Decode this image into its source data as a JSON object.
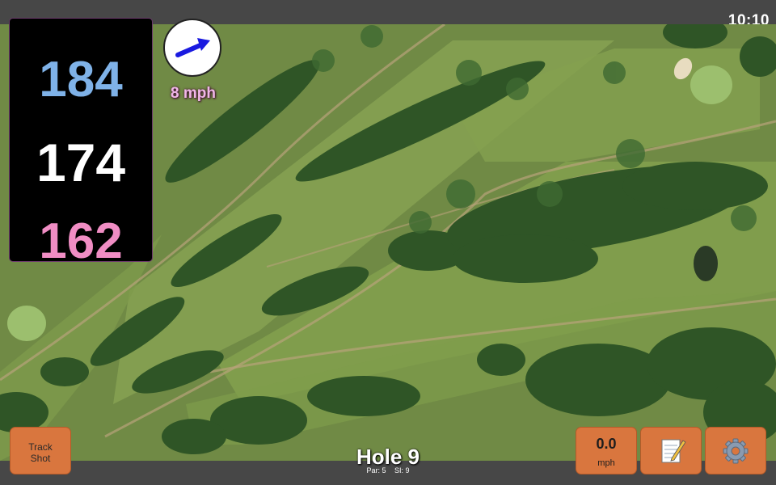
{
  "status_bar": {
    "time": "10:10"
  },
  "distances": {
    "back": "184",
    "middle": "174",
    "front": "162"
  },
  "wind": {
    "speed_label": "8 mph",
    "direction_icon": "arrow-icon",
    "arrow_color": "#1a1ae0"
  },
  "buttons": {
    "track_shot": {
      "line1": "Track",
      "line2": "Shot"
    },
    "speed": {
      "value": "0.0",
      "unit": "mph"
    },
    "notes_icon": "notepad-icon",
    "settings_icon": "gear-icon"
  },
  "hole": {
    "title": "Hole 9",
    "par_label": "Par: 5",
    "si_label": "SI: 9"
  },
  "colors": {
    "back_distance": "#7fb2e8",
    "middle_distance": "#ffffff",
    "front_distance": "#f08dc4",
    "button": "#d9763e",
    "wind_text": "#f0b6e8"
  }
}
